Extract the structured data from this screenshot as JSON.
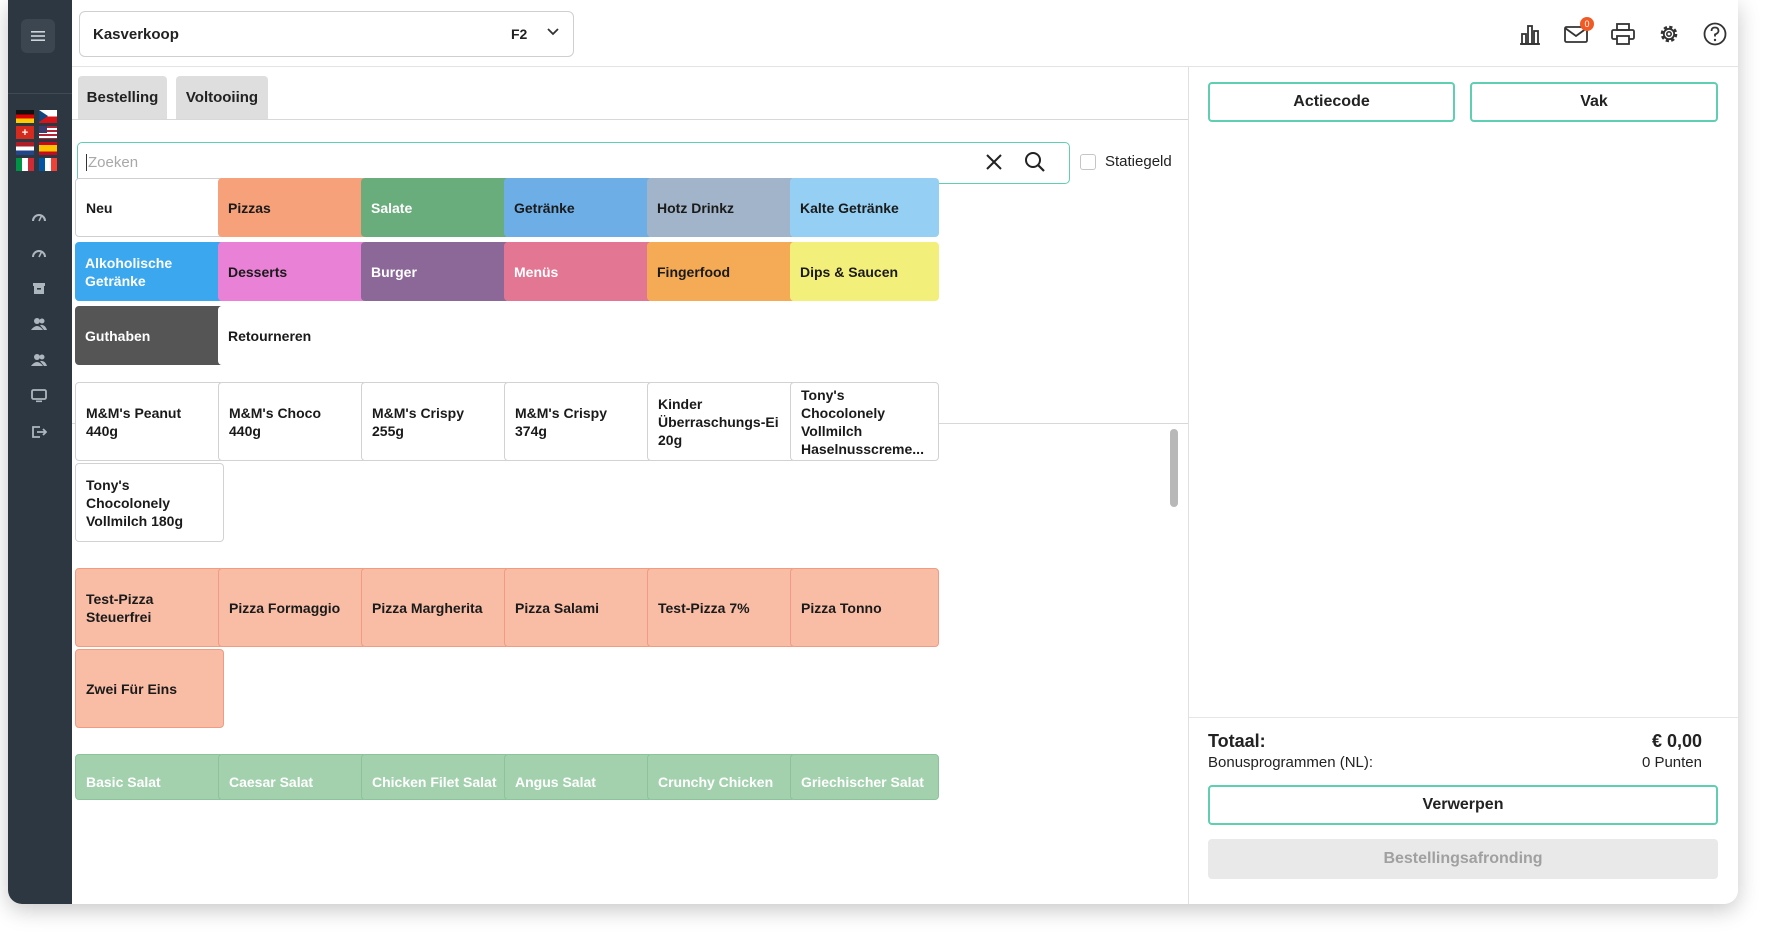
{
  "header": {
    "register": "Kasverkoop",
    "shortcut": "F2",
    "mail_badge": "0"
  },
  "tabs": [
    "Bestelling",
    "Voltooiing"
  ],
  "search": {
    "placeholder": "Zoeken"
  },
  "statiegeld_label": "Statiegeld",
  "categories": [
    {
      "label": "Neu",
      "color": "#ffffff"
    },
    {
      "label": "Pizzas",
      "color": "#f7a17b"
    },
    {
      "label": "Salate",
      "color": "#6aad7c"
    },
    {
      "label": "Getränke",
      "color": "#6daee6"
    },
    {
      "label": "Hotz Drinkz",
      "color": "#a1b4c9"
    },
    {
      "label": "Kalte Getränke",
      "color": "#95d0f4"
    },
    {
      "label": "Alkoholische Getränke",
      "color": "#3aa7ef"
    },
    {
      "label": "Desserts",
      "color": "#e981d6"
    },
    {
      "label": "Burger",
      "color": "#8b6897"
    },
    {
      "label": "Menüs",
      "color": "#e27693"
    },
    {
      "label": "Fingerfood",
      "color": "#f5ab55"
    },
    {
      "label": "Dips & Saucen",
      "color": "#f2f07a"
    },
    {
      "label": "Guthaben",
      "color": "#555555"
    },
    {
      "label": "Retourneren",
      "color": "#ffffff"
    }
  ],
  "products_white": [
    "M&M's Peanut 440g",
    "M&M's Choco 440g",
    "M&M's Crispy 255g",
    "M&M's Crispy 374g",
    "Kinder Überraschungs-Ei 20g",
    "Tony's Chocolonely Vollmilch Haselnusscreme...",
    "Tony's Chocolonely Vollmilch 180g"
  ],
  "products_pizza": [
    "Test-Pizza Steuerfrei",
    "Pizza Formaggio",
    "Pizza Margherita",
    "Pizza Salami",
    "Test-Pizza 7%",
    "Pizza Tonno",
    "Zwei Für Eins"
  ],
  "products_salad": [
    "Basic Salat",
    "Caesar Salat",
    "Chicken Filet Salat",
    "Angus Salat",
    "Crunchy Chicken",
    "Griechischer Salat"
  ],
  "cart": {
    "actiecode_label": "Actiecode",
    "vak_label": "Vak",
    "total_label": "Totaal:",
    "total_value": "€ 0,00",
    "bonus_label": "Bonusprogrammen (NL):",
    "bonus_value": "0 Punten",
    "discard_label": "Verwerpen",
    "checkout_label": "Bestellingsafronding"
  },
  "colors": {
    "accent": "#5ecfb0",
    "sidebar": "#2d3741",
    "pizza_tile": "#f9bda6",
    "salad_tile": "#a3d1ae"
  }
}
